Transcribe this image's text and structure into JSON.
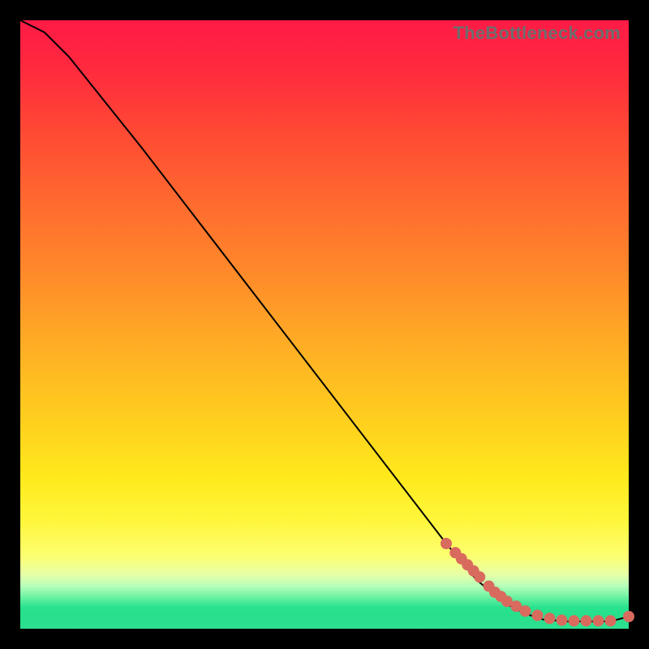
{
  "watermark": "TheBottleneck.com",
  "chart_data": {
    "type": "line",
    "title": "",
    "xlabel": "",
    "ylabel": "",
    "xlim": [
      0,
      100
    ],
    "ylim": [
      0,
      100
    ],
    "grid": false,
    "legend": false,
    "series": [
      {
        "name": "curve",
        "x": [
          0,
          4,
          8,
          12,
          20,
          30,
          40,
          50,
          60,
          70,
          75,
          80,
          83,
          86,
          90,
          94,
          97,
          100
        ],
        "y": [
          100,
          98,
          94,
          89,
          79,
          66,
          53,
          40,
          27,
          14,
          8,
          4,
          2.5,
          1.5,
          1.2,
          1.2,
          1.2,
          2.0
        ]
      }
    ],
    "points": {
      "name": "highlight-dots",
      "x": [
        70,
        71.5,
        72.5,
        73.5,
        74.5,
        75.5,
        77,
        78,
        79,
        80,
        81.5,
        83,
        85,
        87,
        89,
        91,
        93,
        95,
        97,
        100
      ],
      "y": [
        14,
        12.5,
        11.5,
        10.5,
        9.5,
        8.5,
        7,
        6,
        5.3,
        4.5,
        3.7,
        2.9,
        2.2,
        1.7,
        1.4,
        1.3,
        1.3,
        1.3,
        1.3,
        2.0
      ]
    },
    "colors": {
      "line": "#000000",
      "dots": "#d96a5e",
      "gradient_top": "#ff1a46",
      "gradient_mid": "#ffd21e",
      "gradient_bottom": "#28e08c",
      "background": "#000000"
    }
  }
}
